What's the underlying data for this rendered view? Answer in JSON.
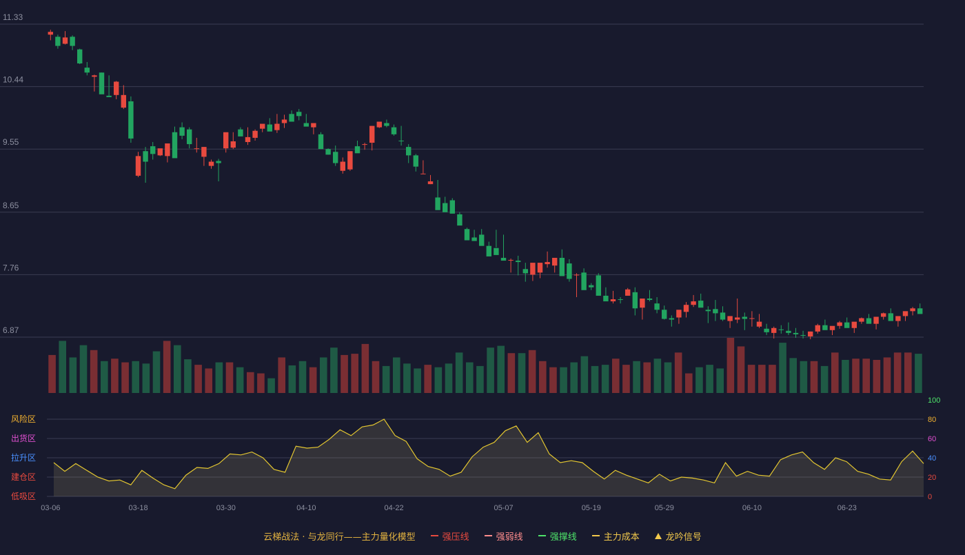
{
  "chart_data": [
    {
      "type": "candlestick",
      "y_ticks": [
        "11.33",
        "10.44",
        "9.55",
        "8.65",
        "7.76",
        "6.87"
      ],
      "ylim": [
        6.87,
        11.33
      ],
      "grid": true,
      "up_color": "#e84a3f",
      "down_color": "#22a560",
      "dates": [
        "03-06",
        "03-07",
        "03-08",
        "03-09",
        "03-10",
        "03-11",
        "03-12",
        "03-13",
        "03-14",
        "03-15",
        "03-16",
        "03-17",
        "03-18",
        "03-19",
        "03-20",
        "03-21",
        "03-22",
        "03-23",
        "03-24",
        "03-25",
        "03-26",
        "03-27",
        "03-28",
        "03-29",
        "03-30",
        "03-31",
        "04-01",
        "04-02",
        "04-03",
        "04-04",
        "04-05",
        "04-06",
        "04-07",
        "04-08",
        "04-09",
        "04-10",
        "04-11",
        "04-12",
        "04-13",
        "04-14",
        "04-15",
        "04-16",
        "04-17",
        "04-18",
        "04-19",
        "04-20",
        "04-21",
        "04-22",
        "04-23",
        "04-24",
        "04-25",
        "04-26",
        "04-27",
        "04-28",
        "04-29",
        "04-30",
        "05-01",
        "05-02",
        "05-03",
        "05-04",
        "05-05",
        "05-06",
        "05-07",
        "05-08",
        "05-09",
        "05-10",
        "05-11",
        "05-12",
        "05-13",
        "05-14",
        "05-15",
        "05-16",
        "05-17",
        "05-18",
        "05-19",
        "05-20",
        "05-21",
        "05-22",
        "05-23",
        "05-24",
        "05-25",
        "05-26",
        "05-27",
        "05-28",
        "05-29",
        "05-30",
        "05-31",
        "06-01",
        "06-02",
        "06-03",
        "06-04",
        "06-05",
        "06-06",
        "06-07",
        "06-08",
        "06-09",
        "06-10",
        "06-11",
        "06-12",
        "06-13",
        "06-14",
        "06-15",
        "06-16",
        "06-17",
        "06-18",
        "06-19",
        "06-20",
        "06-21",
        "06-22",
        "06-23",
        "06-24",
        "06-25",
        "06-26",
        "06-27",
        "06-28",
        "06-29",
        "06-30",
        "07-01",
        "07-02",
        "07-03",
        "07-04",
        "07-05",
        "07-06"
      ],
      "ohlc": [
        [
          11.18,
          11.25,
          11.1,
          11.22
        ],
        [
          11.15,
          11.18,
          10.98,
          11.02
        ],
        [
          11.05,
          11.23,
          11.04,
          11.14
        ],
        [
          11.15,
          11.17,
          10.96,
          11.02
        ],
        [
          10.97,
          10.98,
          10.76,
          10.77
        ],
        [
          10.71,
          10.79,
          10.6,
          10.64
        ],
        [
          10.58,
          10.61,
          10.37,
          10.6
        ],
        [
          10.64,
          10.64,
          10.45,
          10.33
        ],
        [
          10.31,
          10.6,
          10.31,
          10.29
        ],
        [
          10.32,
          10.52,
          10.26,
          10.51
        ],
        [
          10.14,
          10.46,
          10.12,
          10.32
        ],
        [
          10.23,
          10.3,
          9.64,
          9.7
        ],
        [
          9.17,
          9.51,
          9.15,
          9.45
        ],
        [
          9.52,
          9.58,
          9.07,
          9.37
        ],
        [
          9.59,
          9.65,
          9.4,
          9.48
        ],
        [
          9.46,
          9.55,
          9.45,
          9.56
        ],
        [
          9.45,
          9.58,
          9.36,
          9.63
        ],
        [
          9.79,
          9.87,
          9.74,
          9.42
        ],
        [
          9.86,
          9.93,
          9.69,
          9.74
        ],
        [
          9.83,
          9.86,
          9.56,
          9.62
        ],
        [
          9.55,
          9.71,
          9.5,
          9.56
        ],
        [
          9.44,
          9.58,
          9.31,
          9.58
        ],
        [
          9.31,
          9.4,
          9.27,
          9.37
        ],
        [
          9.38,
          9.41,
          9.09,
          9.35
        ],
        [
          9.56,
          9.58,
          9.5,
          9.79
        ],
        [
          9.57,
          9.79,
          9.55,
          9.66
        ],
        [
          9.83,
          9.86,
          9.78,
          9.73
        ],
        [
          9.65,
          9.86,
          9.61,
          9.72
        ],
        [
          9.71,
          9.83,
          9.67,
          9.81
        ],
        [
          9.84,
          9.89,
          9.79,
          9.91
        ],
        [
          9.9,
          9.99,
          9.82,
          9.8
        ],
        [
          9.82,
          10.05,
          9.78,
          9.91
        ],
        [
          9.92,
          10.04,
          9.85,
          9.97
        ],
        [
          10.05,
          10.1,
          10.0,
          9.94
        ],
        [
          10.08,
          10.12,
          9.96,
          10.02
        ],
        [
          9.92,
          10.05,
          9.88,
          9.87
        ],
        [
          9.86,
          9.88,
          9.76,
          9.92
        ],
        [
          9.76,
          9.79,
          9.59,
          9.55
        ],
        [
          9.55,
          9.56,
          9.47,
          9.47
        ],
        [
          9.51,
          9.6,
          9.31,
          9.35
        ],
        [
          9.24,
          9.43,
          9.2,
          9.37
        ],
        [
          9.26,
          9.5,
          9.24,
          9.52
        ],
        [
          9.59,
          9.67,
          9.51,
          9.49
        ],
        [
          9.61,
          9.64,
          9.54,
          9.62
        ],
        [
          9.64,
          9.88,
          9.53,
          9.88
        ],
        [
          9.86,
          9.92,
          9.85,
          9.94
        ],
        [
          9.92,
          9.97,
          9.86,
          9.88
        ],
        [
          9.86,
          9.9,
          9.74,
          9.76
        ],
        [
          9.67,
          9.88,
          9.6,
          9.66
        ],
        [
          9.58,
          9.62,
          9.35,
          9.46
        ],
        [
          9.46,
          9.48,
          9.23,
          9.3
        ],
        [
          9.2,
          9.39,
          9.2,
          9.2
        ],
        [
          9.05,
          9.18,
          9.05,
          9.09
        ],
        [
          8.86,
          9.11,
          8.75,
          8.68
        ],
        [
          8.78,
          8.87,
          8.75,
          8.65
        ],
        [
          8.82,
          8.85,
          8.66,
          8.63
        ],
        [
          8.62,
          8.65,
          8.48,
          8.46
        ],
        [
          8.41,
          8.43,
          8.25,
          8.25
        ],
        [
          8.29,
          8.4,
          8.26,
          8.24
        ],
        [
          8.33,
          8.41,
          8.27,
          8.17
        ],
        [
          8.17,
          8.23,
          8.11,
          8.02
        ],
        [
          8.14,
          8.4,
          8.15,
          8.04
        ],
        [
          8.0,
          8.33,
          7.97,
          7.96
        ],
        [
          7.96,
          7.99,
          7.79,
          7.97
        ],
        [
          7.96,
          8.03,
          7.75,
          7.94
        ],
        [
          7.84,
          7.93,
          7.66,
          7.78
        ],
        [
          7.76,
          7.87,
          7.67,
          7.93
        ],
        [
          7.79,
          7.83,
          7.71,
          7.93
        ],
        [
          7.91,
          8.09,
          7.86,
          7.94
        ],
        [
          7.89,
          7.93,
          7.79,
          8.0
        ],
        [
          8.0,
          8.12,
          7.87,
          7.74
        ],
        [
          7.92,
          7.98,
          7.66,
          7.7
        ],
        [
          7.75,
          7.78,
          7.44,
          7.76
        ],
        [
          7.79,
          7.85,
          7.58,
          7.54
        ],
        [
          7.61,
          7.64,
          7.54,
          7.58
        ],
        [
          7.75,
          7.78,
          7.54,
          7.46
        ],
        [
          7.46,
          7.58,
          7.39,
          7.38
        ],
        [
          7.38,
          7.53,
          7.35,
          7.41
        ],
        [
          7.41,
          7.44,
          7.35,
          7.4
        ],
        [
          7.46,
          7.57,
          7.51,
          7.55
        ],
        [
          7.51,
          7.58,
          7.18,
          7.28
        ],
        [
          7.29,
          7.39,
          7.12,
          7.42
        ],
        [
          7.42,
          7.54,
          7.38,
          7.4
        ],
        [
          7.35,
          7.44,
          7.21,
          7.26
        ],
        [
          7.26,
          7.32,
          7.12,
          7.13
        ],
        [
          7.14,
          7.18,
          7.02,
          7.12
        ],
        [
          7.15,
          7.22,
          7.06,
          7.26
        ],
        [
          7.23,
          7.37,
          7.15,
          7.33
        ],
        [
          7.33,
          7.47,
          7.3,
          7.38
        ],
        [
          7.39,
          7.49,
          7.33,
          7.29
        ],
        [
          7.26,
          7.31,
          7.07,
          7.24
        ],
        [
          7.27,
          7.4,
          7.1,
          7.21
        ],
        [
          7.22,
          7.31,
          7.1,
          7.12
        ],
        [
          7.1,
          7.17,
          7.0,
          7.17
        ],
        [
          7.12,
          7.42,
          7.07,
          7.15
        ],
        [
          7.16,
          7.22,
          6.97,
          7.13
        ],
        [
          7.13,
          7.24,
          7.02,
          7.14
        ],
        [
          7.02,
          7.2,
          7.0,
          7.09
        ],
        [
          6.99,
          7.06,
          6.9,
          6.94
        ],
        [
          6.93,
          7.02,
          6.85,
          7.0
        ],
        [
          6.98,
          7.04,
          6.92,
          6.97
        ],
        [
          6.96,
          7.08,
          6.9,
          6.93
        ],
        [
          6.93,
          7.0,
          6.86,
          6.91
        ],
        [
          6.9,
          6.96,
          6.85,
          6.89
        ],
        [
          6.88,
          6.95,
          6.84,
          6.95
        ],
        [
          6.95,
          7.06,
          6.92,
          7.04
        ],
        [
          7.04,
          7.12,
          7.0,
          6.97
        ],
        [
          6.97,
          7.0,
          6.9,
          7.03
        ],
        [
          7.03,
          7.1,
          6.99,
          7.08
        ],
        [
          7.08,
          7.15,
          7.02,
          7.0
        ],
        [
          7.0,
          7.05,
          6.93,
          7.09
        ],
        [
          7.09,
          7.15,
          7.06,
          7.14
        ],
        [
          7.14,
          7.2,
          7.08,
          7.06
        ],
        [
          7.06,
          7.1,
          6.98,
          7.16
        ],
        [
          7.16,
          7.22,
          7.12,
          7.21
        ],
        [
          7.21,
          7.28,
          7.16,
          7.1
        ],
        [
          7.1,
          7.15,
          7.02,
          7.17
        ],
        [
          7.17,
          7.22,
          7.1,
          7.24
        ],
        [
          7.24,
          7.3,
          7.18,
          7.28
        ],
        [
          7.28,
          7.35,
          7.22,
          7.2
        ]
      ]
    },
    {
      "type": "bar",
      "name": "volume",
      "values": [
        62,
        85,
        58,
        78,
        70,
        52,
        56,
        50,
        52,
        48,
        68,
        85,
        78,
        55,
        46,
        40,
        50,
        50,
        42,
        34,
        32,
        24,
        58,
        45,
        52,
        42,
        58,
        74,
        62,
        64,
        80,
        52,
        44,
        58,
        48,
        40,
        46,
        42,
        48,
        66,
        50,
        44,
        74,
        77,
        65,
        65,
        70,
        52,
        42,
        42,
        50,
        60,
        44,
        46,
        56,
        46,
        52,
        50,
        56,
        50,
        66,
        32,
        42,
        46,
        40,
        90,
        76,
        46,
        46,
        46,
        82,
        57,
        52,
        52,
        44,
        66,
        54,
        56,
        56,
        54,
        58,
        66,
        66,
        64
      ]
    },
    {
      "type": "area",
      "y_ticks": [
        "100",
        "80",
        "60",
        "40",
        "20",
        "0"
      ],
      "ylim": [
        0,
        100
      ],
      "zones": [
        "风险区",
        "出货区",
        "拉升区",
        "建仓区",
        "低吸区"
      ],
      "values": [
        35,
        26,
        34,
        27,
        20,
        16,
        17,
        12,
        27,
        19,
        12,
        8,
        22,
        30,
        29,
        34,
        44,
        43,
        46,
        40,
        28,
        25,
        52,
        50,
        51,
        59,
        69,
        63,
        72,
        74,
        80,
        63,
        57,
        39,
        31,
        28,
        21,
        25,
        41,
        51,
        56,
        68,
        73,
        56,
        66,
        44,
        35,
        37,
        35,
        26,
        18,
        27,
        22,
        18,
        14,
        23,
        16,
        20,
        19,
        17,
        14,
        35,
        21,
        26,
        22,
        21,
        38,
        43,
        46,
        35,
        28,
        40,
        36,
        26,
        23,
        18,
        17,
        36,
        47,
        34
      ]
    }
  ],
  "x_ticks": [
    "03-06",
    "03-18",
    "03-30",
    "04-10",
    "04-22",
    "05-07",
    "05-19",
    "05-29",
    "06-10",
    "06-23"
  ],
  "legend": {
    "title": "云梯战法 · 与龙同行——主力量化模型",
    "items": [
      {
        "label": "强压线",
        "color": "#e84a3f"
      },
      {
        "label": "强弱线",
        "color": "#ff8d8d"
      },
      {
        "label": "强撑线",
        "color": "#4ee46a"
      },
      {
        "label": "主力成本",
        "color": "#f2c94c"
      },
      {
        "label": "龙吟信号",
        "color": "#f2c94c"
      }
    ]
  },
  "colors": {
    "background": "#181a2d",
    "grid": "#3a3c52",
    "axis_text": "#8c8f9f",
    "line": "#e3c630",
    "zone_risk": "#f0b030",
    "zone_ship": "#e050d0",
    "zone_rise": "#4a90ff",
    "zone_build": "#e84a3f",
    "zone_low": "#e84a3f"
  }
}
